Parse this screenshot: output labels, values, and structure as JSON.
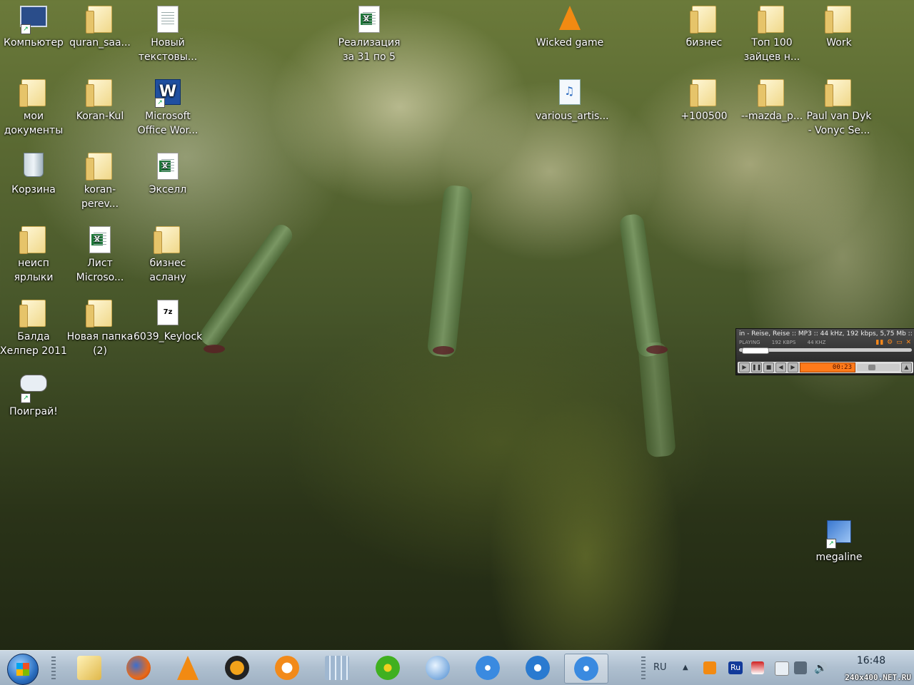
{
  "desktop": {
    "icons": [
      {
        "label": "Компьютер"
      },
      {
        "label": "quran_saa..."
      },
      {
        "label": "Новый текстовы..."
      },
      {
        "label": "Реализация за 31 по 5"
      },
      {
        "label": "Wicked game"
      },
      {
        "label": "бизнес"
      },
      {
        "label": "Топ 100 зайцев н..."
      },
      {
        "label": "Work"
      },
      {
        "label": "мои документы"
      },
      {
        "label": "Koran-Kul"
      },
      {
        "label": "Microsoft Office Wor..."
      },
      {
        "label": "various_artis..."
      },
      {
        "label": "+100500"
      },
      {
        "label": "--mazda_p..."
      },
      {
        "label": "Paul van Dyk - Vonyc Se..."
      },
      {
        "label": "Корзина"
      },
      {
        "label": "koran-perev..."
      },
      {
        "label": "Экселл"
      },
      {
        "label": "неисп ярлыки"
      },
      {
        "label": "Лист Microso..."
      },
      {
        "label": "бизнес аслану"
      },
      {
        "label": "Балда Хелпер 2011"
      },
      {
        "label": "Новая папка (2)"
      },
      {
        "label": "6039_Keylock"
      },
      {
        "label": "Поиграй!"
      },
      {
        "label": "megaline"
      }
    ]
  },
  "player": {
    "title": "in - Reise, Reise :: MP3 :: 44 kHz, 192 kbps, 5,75 Mb ::",
    "state": "PLAYING",
    "bitrate": "192 KBPS",
    "samplerate": "44 KHZ",
    "time": "00:23",
    "volume_label": "VOLUME",
    "seek_fraction": 0.12
  },
  "taskbar": {
    "language": "RU",
    "lang_badge": "Ru",
    "clock": "16:48"
  },
  "watermark": "240x400.NET.RU"
}
